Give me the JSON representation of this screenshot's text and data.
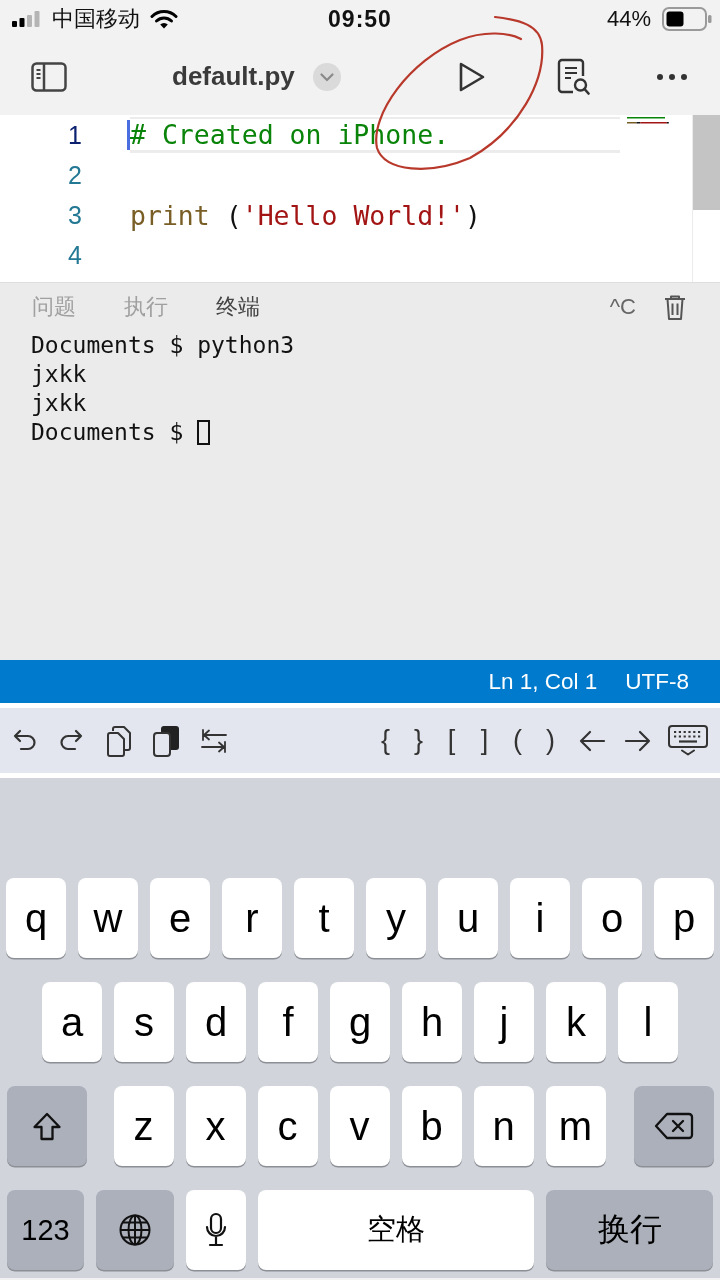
{
  "status_bar": {
    "carrier": "中国移动",
    "time": "09:50",
    "battery": "44%"
  },
  "toolbar": {
    "title": "default.py"
  },
  "editor": {
    "lines": [
      {
        "number": "1",
        "current": true,
        "tokens": [
          {
            "kind": "comment",
            "text": "# Created on iPhone."
          }
        ]
      },
      {
        "number": "2",
        "current": false
      },
      {
        "number": "3",
        "current": false,
        "tokens": [
          {
            "kind": "function",
            "text": "print"
          },
          {
            "kind": "punctuation",
            "text": " ("
          },
          {
            "kind": "string",
            "text": "'Hello World!'"
          },
          {
            "kind": "punctuation",
            "text": ")"
          }
        ]
      },
      {
        "number": "4",
        "current": false
      }
    ]
  },
  "panel": {
    "tabs": [
      {
        "label": "问题",
        "selected": false
      },
      {
        "label": "执行",
        "selected": false
      },
      {
        "label": "终端",
        "selected": true
      }
    ],
    "interrupt": "^C",
    "terminal": {
      "lines": [
        "Documents $ python3",
        "jxkk",
        "jxkk"
      ],
      "prompt": "Documents $"
    }
  },
  "status_line": {
    "position": "Ln 1, Col 1",
    "encoding": "UTF-8"
  },
  "accessory_bar": {
    "symbols": [
      "{",
      "}",
      "[",
      "]",
      "(",
      ")"
    ]
  },
  "keyboard": {
    "rows": [
      {
        "keys": [
          {
            "kind": "letter",
            "label": "q"
          },
          {
            "kind": "letter",
            "label": "w"
          },
          {
            "kind": "letter",
            "label": "e"
          },
          {
            "kind": "letter",
            "label": "r"
          },
          {
            "kind": "letter",
            "label": "t"
          },
          {
            "kind": "letter",
            "label": "y"
          },
          {
            "kind": "letter",
            "label": "u"
          },
          {
            "kind": "letter",
            "label": "i"
          },
          {
            "kind": "letter",
            "label": "o"
          },
          {
            "kind": "letter",
            "label": "p"
          }
        ]
      },
      {
        "keys": [
          {
            "kind": "letter",
            "label": "a"
          },
          {
            "kind": "letter",
            "label": "s"
          },
          {
            "kind": "letter",
            "label": "d"
          },
          {
            "kind": "letter",
            "label": "f"
          },
          {
            "kind": "letter",
            "label": "g"
          },
          {
            "kind": "letter",
            "label": "h"
          },
          {
            "kind": "letter",
            "label": "j"
          },
          {
            "kind": "letter",
            "label": "k"
          },
          {
            "kind": "letter",
            "label": "l"
          }
        ]
      },
      {
        "keys": [
          {
            "kind": "shift"
          },
          {
            "kind": "letter",
            "label": "z"
          },
          {
            "kind": "letter",
            "label": "x"
          },
          {
            "kind": "letter",
            "label": "c"
          },
          {
            "kind": "letter",
            "label": "v"
          },
          {
            "kind": "letter",
            "label": "b"
          },
          {
            "kind": "letter",
            "label": "n"
          },
          {
            "kind": "letter",
            "label": "m"
          },
          {
            "kind": "delete"
          }
        ]
      },
      {
        "keys": [
          {
            "kind": "numbers",
            "label": "123"
          },
          {
            "kind": "globe"
          },
          {
            "kind": "mic"
          },
          {
            "kind": "space",
            "label": "空格"
          },
          {
            "kind": "return",
            "label": "换行"
          }
        ]
      }
    ]
  }
}
